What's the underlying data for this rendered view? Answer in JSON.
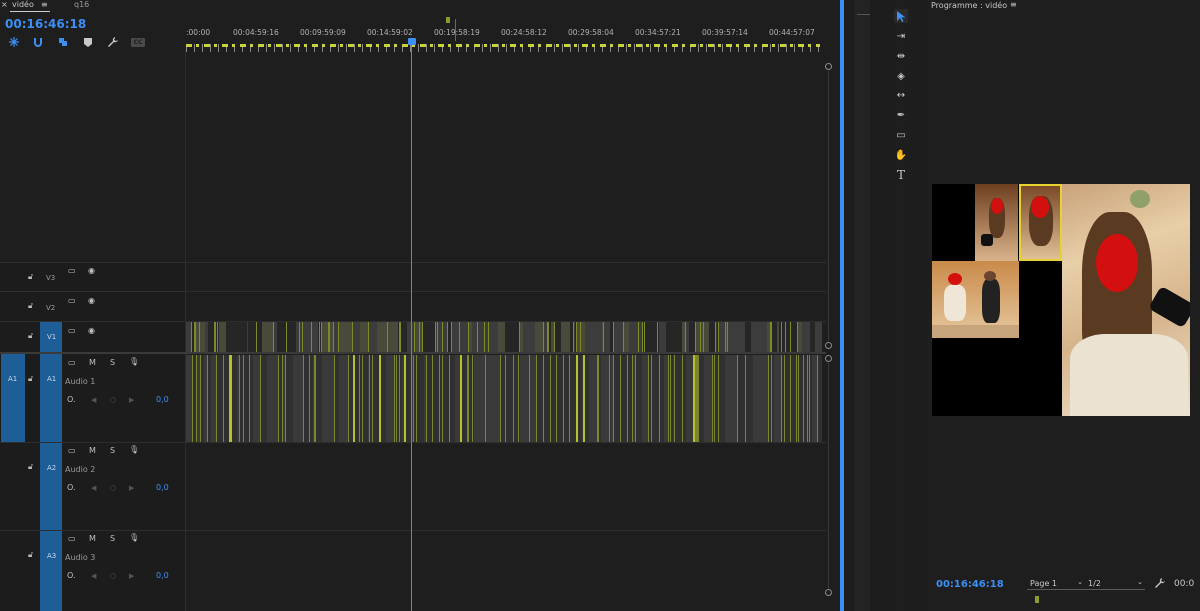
{
  "timeline_panel": {
    "tabs": {
      "close": "×",
      "active_tab": "vidéo",
      "menu": "≡",
      "other_tab": "q16"
    },
    "current_timecode": "00:16:46:18",
    "ruler_labels": [
      ":00:00",
      "00:04:59:16",
      "00:09:59:09",
      "00:14:59:02",
      "00:19:58:19",
      "00:24:58:12",
      "00:29:58:04",
      "00:34:57:21",
      "00:39:57:14",
      "00:44:57:07"
    ],
    "tools": [
      "snap-icon",
      "magnet-icon",
      "linked-selection-icon",
      "marker-icon",
      "wrench-icon",
      "captions-icon"
    ],
    "captions_label": "CC",
    "video_tracks": [
      {
        "id": "V3",
        "source": ""
      },
      {
        "id": "V2",
        "source": ""
      },
      {
        "id": "V1",
        "source": "V1"
      }
    ],
    "audio_tracks": [
      {
        "source": "A1",
        "id": "A1",
        "name": "Audio 1",
        "mute": "M",
        "solo": "S",
        "volume": "0,0"
      },
      {
        "source": "",
        "id": "A2",
        "name": "Audio 2",
        "mute": "M",
        "solo": "S",
        "volume": "0,0"
      },
      {
        "source": "",
        "id": "A3",
        "name": "Audio 3",
        "mute": "M",
        "solo": "S",
        "volume": "0,0"
      }
    ],
    "colors": {
      "accent": "#3b8ff5",
      "track_blue": "#1d5e96",
      "audio_wave": "#b5c22e",
      "ruler_yellow": "#c8d23a"
    }
  },
  "tools_panel": {
    "tools": [
      "selection-tool-icon",
      "track-select-icon",
      "ripple-edit-icon",
      "razor-icon",
      "slip-icon",
      "pen-icon",
      "rectangle-icon",
      "hand-icon",
      "type-icon"
    ]
  },
  "program_monitor": {
    "title": "Programme : vidéo",
    "menu": "≡",
    "timecode": "00:16:46:18",
    "page_select": "Page 1",
    "page_fraction": "1/2",
    "timecode_partial": "00:0"
  }
}
